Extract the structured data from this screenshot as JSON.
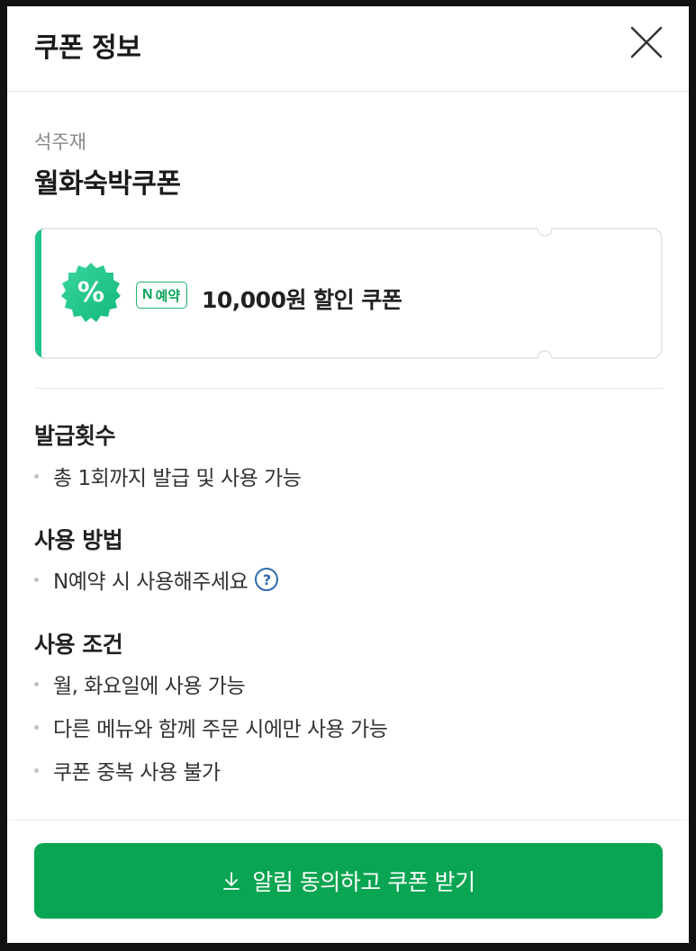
{
  "header": {
    "title": "쿠폰 정보"
  },
  "coupon": {
    "shop_name": "석주재",
    "name": "월화숙박쿠폰",
    "badge_symbol": "%",
    "provider_n": "N",
    "provider_label": "예약",
    "discount_text": "10,000원 할인 쿠폰"
  },
  "sections": {
    "issue": {
      "title": "발급횟수",
      "items": [
        "총 1회까지 발급 및 사용 가능"
      ]
    },
    "method": {
      "title": "사용 방법",
      "items": [
        "N예약 시 사용해주세요"
      ],
      "help_icon": "?"
    },
    "conditions": {
      "title": "사용 조건",
      "items": [
        "월, 화요일에 사용 가능",
        "다른 메뉴와 함께 주문 시에만 사용 가능",
        "쿠폰 중복 사용 불가"
      ]
    }
  },
  "cta": {
    "label": "알림 동의하고 쿠폰 받기"
  },
  "colors": {
    "accent_green": "#0aa552",
    "badge_green": "#1db56e",
    "help_blue": "#2d6bb0"
  }
}
